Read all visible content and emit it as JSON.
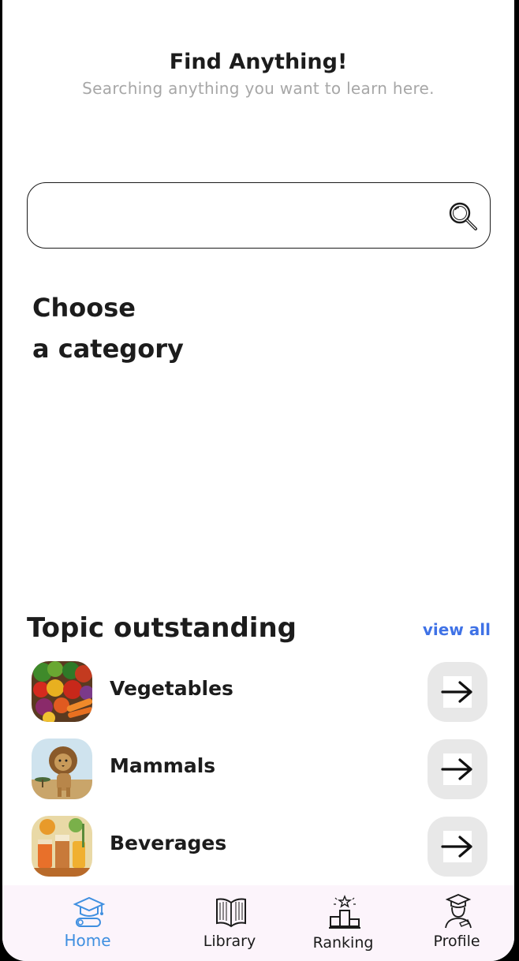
{
  "header": {
    "title": "Find Anything!",
    "subtitle": "Searching anything you want to learn here."
  },
  "search": {
    "value": "",
    "placeholder": ""
  },
  "category": {
    "line1": "Choose",
    "line2": "a category"
  },
  "topics": {
    "title": "Topic outstanding",
    "view_all": "view all",
    "items": [
      {
        "name": "Vegetables",
        "image": "vegetables-photo"
      },
      {
        "name": "Mammals",
        "image": "lion-illustration"
      },
      {
        "name": "Beverages",
        "image": "beverages-illustration"
      }
    ]
  },
  "tabbar": {
    "items": [
      {
        "label": "Home",
        "icon": "graduation-cap-icon",
        "active": true
      },
      {
        "label": "Library",
        "icon": "open-book-icon",
        "active": false
      },
      {
        "label": "Ranking",
        "icon": "podium-icon",
        "active": false
      },
      {
        "label": "Profile",
        "icon": "graduate-person-icon",
        "active": false
      }
    ]
  },
  "colors": {
    "accent": "#3f72e6",
    "tab_active": "#3f8fe0",
    "tabbar_bg": "#fcf4fb",
    "arrow_button_bg": "#e8e8e8"
  }
}
